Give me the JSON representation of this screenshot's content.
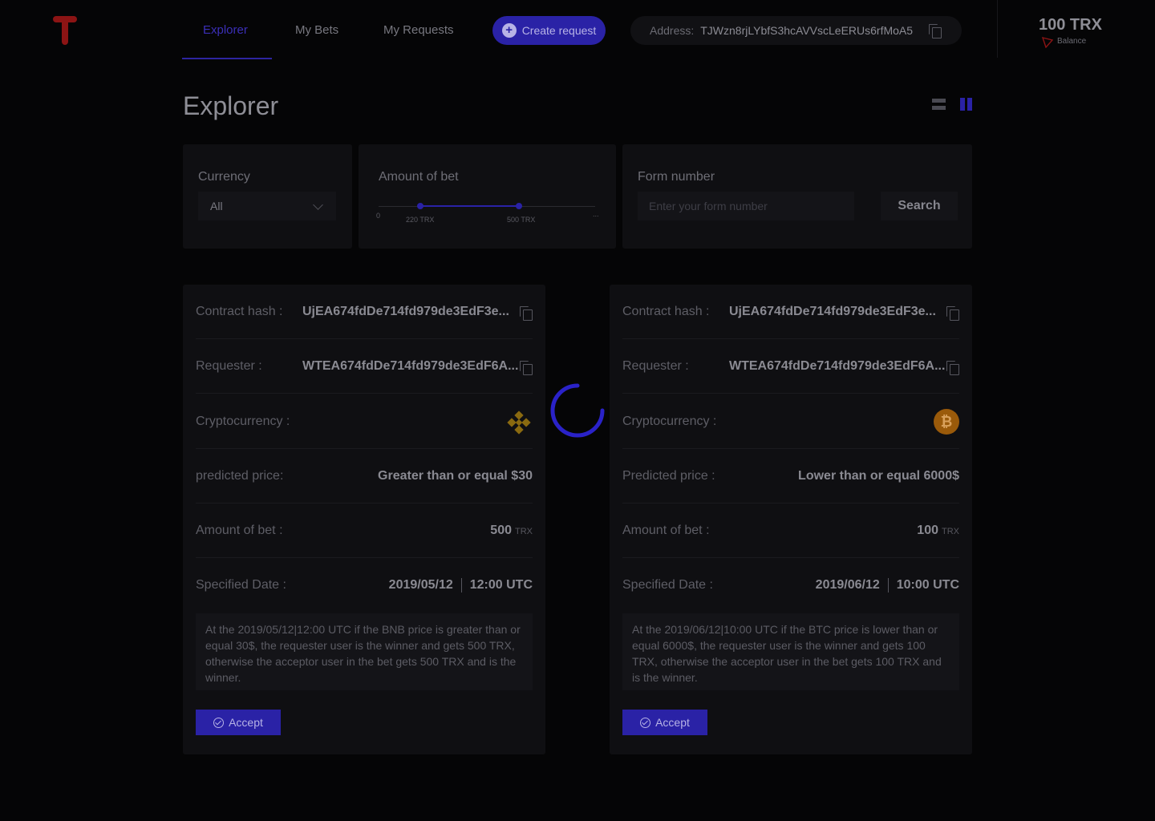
{
  "nav": {
    "items": [
      "Explorer",
      "My Bets",
      "My Requests"
    ],
    "create_label": "Create request",
    "address_label": "Address:",
    "address_value": "TJWzn8rjLYbfS3hcAVVscLeERUs6rfMoA5",
    "balance_value": "100 TRX",
    "balance_label": "Balance"
  },
  "page": {
    "title": "Explorer"
  },
  "filters": {
    "currency_label": "Currency",
    "currency_value": "All",
    "amount_label": "Amount of bet",
    "slider_min": "0",
    "slider_low": "220 TRX",
    "slider_high": "500 TRX",
    "slider_max": "...",
    "form_label": "Form number",
    "form_placeholder": "Enter your form number",
    "search_label": "Search"
  },
  "cards": [
    {
      "contract_label": "Contract hash :",
      "contract_value": "UjEA674fdDe714fd979de3EdF3e...",
      "requester_label": "Requester :",
      "requester_value": "WTEA674fdDe714fd979de3EdF6A...",
      "crypto_label": "Cryptocurrency :",
      "crypto_icon": "bnb-icon",
      "price_label": "predicted price:",
      "price_value": "Greater than or equal $30",
      "amount_label": "Amount of bet :",
      "amount_value": "500",
      "amount_unit": "TRX",
      "date_label": "Specified Date :",
      "date_value": "2019/05/12",
      "time_value": "12:00 UTC",
      "description": "At the 2019/05/12|12:00 UTC  if the  BNB price is greater than or equal 30$, the requester user is the winner and gets 500 TRX, otherwise the acceptor user in the bet gets 500 TRX and  is the winner.",
      "accept_label": "Accept"
    },
    {
      "contract_label": "Contract hash :",
      "contract_value": "UjEA674fdDe714fd979de3EdF3e...",
      "requester_label": "Requester :",
      "requester_value": "WTEA674fdDe714fd979de3EdF6A...",
      "crypto_label": "Cryptocurrency :",
      "crypto_icon": "btc-icon",
      "price_label": "Predicted price :",
      "price_value": "Lower than or equal  6000$",
      "amount_label": "Amount of bet :",
      "amount_value": "100",
      "amount_unit": "TRX",
      "date_label": "Specified Date :",
      "date_value": "2019/06/12",
      "time_value": "10:00 UTC",
      "description": "At the 2019/06/12|10:00 UTC  if the  BTC price is lower than or equal 6000$, the requester user is the winner and gets 100 TRX, otherwise the acceptor user in the bet gets 100 TRX and  is the winner.",
      "accept_label": "Accept"
    }
  ],
  "colors": {
    "accent": "#2a22a6",
    "brand_red": "#8c1414",
    "background": "#050506",
    "panel": "#0f0f12"
  }
}
